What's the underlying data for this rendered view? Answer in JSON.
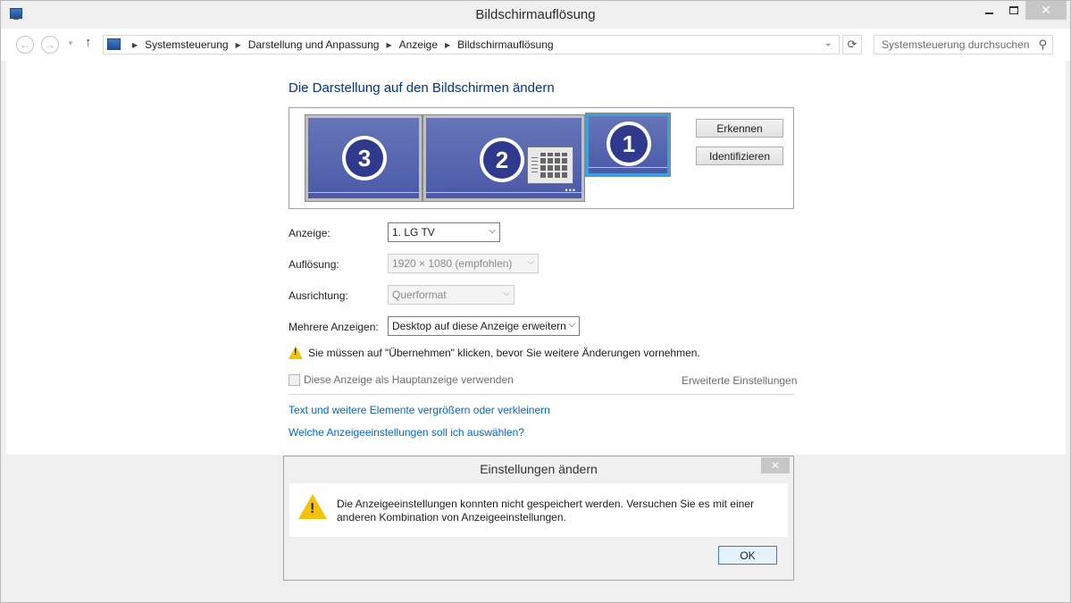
{
  "window": {
    "title": "Bildschirmauflösung",
    "close_glyph": "✕"
  },
  "navigation": {
    "breadcrumbs": [
      "Systemsteuerung",
      "Darstellung und Anpassung",
      "Anzeige",
      "Bildschirmauflösung"
    ],
    "search_placeholder": "Systemsteuerung durchsuchen"
  },
  "main": {
    "heading": "Die Darstellung auf den Bildschirmen ändern",
    "monitors": [
      {
        "number": "3"
      },
      {
        "number": "2"
      },
      {
        "number": "1",
        "selected": true
      }
    ],
    "detect_button": "Erkennen",
    "identify_button": "Identifizieren",
    "display_label": "Anzeige:",
    "display_value": "1. LG TV",
    "resolution_label": "Auflösung:",
    "resolution_value": "1920 × 1080 (empfohlen)",
    "orientation_label": "Ausrichtung:",
    "orientation_value": "Querformat",
    "multiple_label": "Mehrere Anzeigen:",
    "multiple_value": "Desktop auf diese Anzeige erweitern",
    "warning_text": "Sie müssen auf \"Übernehmen\" klicken, bevor Sie weitere Änderungen vornehmen.",
    "main_display_checkbox": "Diese Anzeige als Hauptanzeige verwenden",
    "advanced_link": "Erweiterte Einstellungen",
    "link_text_size": "Text und weitere Elemente vergrößern oder verkleinern",
    "link_which_settings": "Welche Anzeigeeinstellungen soll ich auswählen?"
  },
  "dialog": {
    "title": "Einstellungen ändern",
    "message": "Die Anzeigeeinstellungen konnten nicht gespeichert werden. Versuchen Sie es mit einer anderen Kombination von Anzeigeeinstellungen.",
    "ok_button": "OK",
    "close_glyph": "✕"
  },
  "colors": {
    "heading": "#003399",
    "link": "#0066cc",
    "monitor_fill": "#5563ac",
    "selected_border": "#3aa0e0",
    "warning": "#f5c400"
  }
}
